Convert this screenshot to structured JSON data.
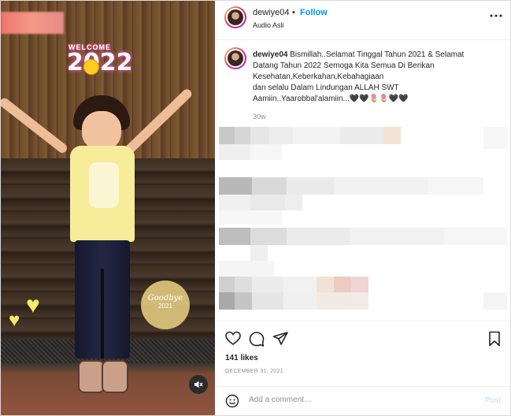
{
  "media": {
    "sticker_welcome": "WELCOME",
    "sticker_year": "2022",
    "sticker_goodbye": "Goodbye",
    "sticker_goodbye_year": "2021",
    "sound_icon": "speaker-muted-icon"
  },
  "header": {
    "username": "dewiye04",
    "separator": "•",
    "follow_label": "Follow",
    "audio_label": "Audio Asli",
    "more_icon": "more-options-icon"
  },
  "caption": {
    "username": "dewiye04",
    "text_line1": "Bismillah..Selamat Tinggal Tahun 2021 & Selamat Datang Tahun 2022 Semoga Kita Semua Di Berikan Kesehatan,Keberkahan,Kebahagiaan",
    "text_line2": "dan selalu Dalam Lindungan ALLAH SWT",
    "text_line3": "Aamiin..Yaarobbal'alamiin...🖤🖤🌷🌷🖤🖤",
    "time_ago": "30w"
  },
  "actions": {
    "like_icon": "heart-icon",
    "comment_icon": "comment-icon",
    "share_icon": "share-icon",
    "save_icon": "bookmark-icon"
  },
  "likes_text": "141 likes",
  "post_date": "DECEMBER 31, 2021",
  "comment_box": {
    "emoji_icon": "emoji-icon",
    "placeholder": "Add a comment…",
    "post_label": "Post"
  },
  "colors": {
    "accent": "#0095f6",
    "post_disabled": "#b2dffc",
    "muted_text": "#8e8e8e"
  }
}
